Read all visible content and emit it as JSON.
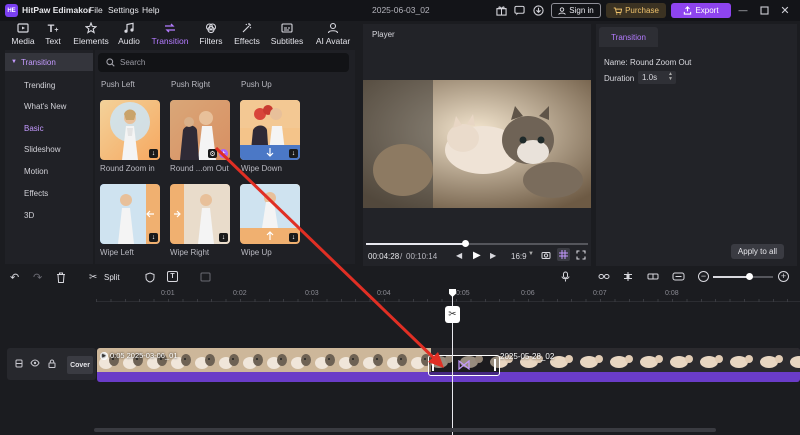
{
  "app": {
    "name": "HitPaw Edimakor",
    "logo": "HE",
    "project_title": "2025-06-03_02"
  },
  "menu": [
    "File",
    "Settings",
    "Help"
  ],
  "header": {
    "sign_in": "Sign in",
    "purchase": "Purchase",
    "export": "Export"
  },
  "tabs": [
    {
      "label": "Media",
      "icon": "media-icon"
    },
    {
      "label": "Text",
      "icon": "text-icon"
    },
    {
      "label": "Elements",
      "icon": "elements-icon"
    },
    {
      "label": "Audio",
      "icon": "audio-icon"
    },
    {
      "label": "Transition",
      "icon": "transition-icon",
      "active": true
    },
    {
      "label": "Filters",
      "icon": "filters-icon"
    },
    {
      "label": "Effects",
      "icon": "effects-icon"
    },
    {
      "label": "Subtitles",
      "icon": "subtitles-icon"
    },
    {
      "label": "AI Avatar",
      "icon": "ai-avatar-icon"
    }
  ],
  "sidebar": {
    "header": "Transition",
    "items": [
      "Trending",
      "What's New",
      "Basic",
      "Slideshow",
      "Motion",
      "Effects",
      "3D"
    ],
    "selected": "Basic"
  },
  "search": {
    "placeholder": "Search"
  },
  "transitions": {
    "top_labels": [
      "Push Left",
      "Push Right",
      "Push Up"
    ],
    "row1": [
      "Round Zoom in",
      "Round ...om Out",
      "Wipe Down"
    ],
    "row2": [
      "Wipe Left",
      "Wipe Right",
      "Wipe Up"
    ]
  },
  "player": {
    "title": "Player",
    "current_time": "00:04:28",
    "separator": "/",
    "total_time": "00:10:14",
    "aspect": "16:9",
    "progress": 0.45
  },
  "properties": {
    "tab": "Transition",
    "name_label": "Name:",
    "name_value": "Round Zoom Out",
    "duration_label": "Duration",
    "duration_value": "1.0s",
    "apply_all": "Apply to all"
  },
  "timeline": {
    "split_label": "Split",
    "ticks": [
      "0:01",
      "0:02",
      "0:03",
      "0:04",
      "0:05",
      "0:06",
      "0:07",
      "0:08"
    ],
    "cover_label": "Cover",
    "clip1": {
      "duration": "0:05",
      "name": "2025-03-06_01"
    },
    "clip2": {
      "name": "2025-05-28_02"
    },
    "transition_icon": "bowtie-icon",
    "zoom_level": 0.6
  },
  "colors": {
    "accent": "#a96cff",
    "export": "#8e44ef",
    "purchase_bg": "#3b3222",
    "purchase_text": "#f0c36c",
    "annotation_arrow": "#e02f24",
    "clip_bar": "#6a3cc8"
  }
}
